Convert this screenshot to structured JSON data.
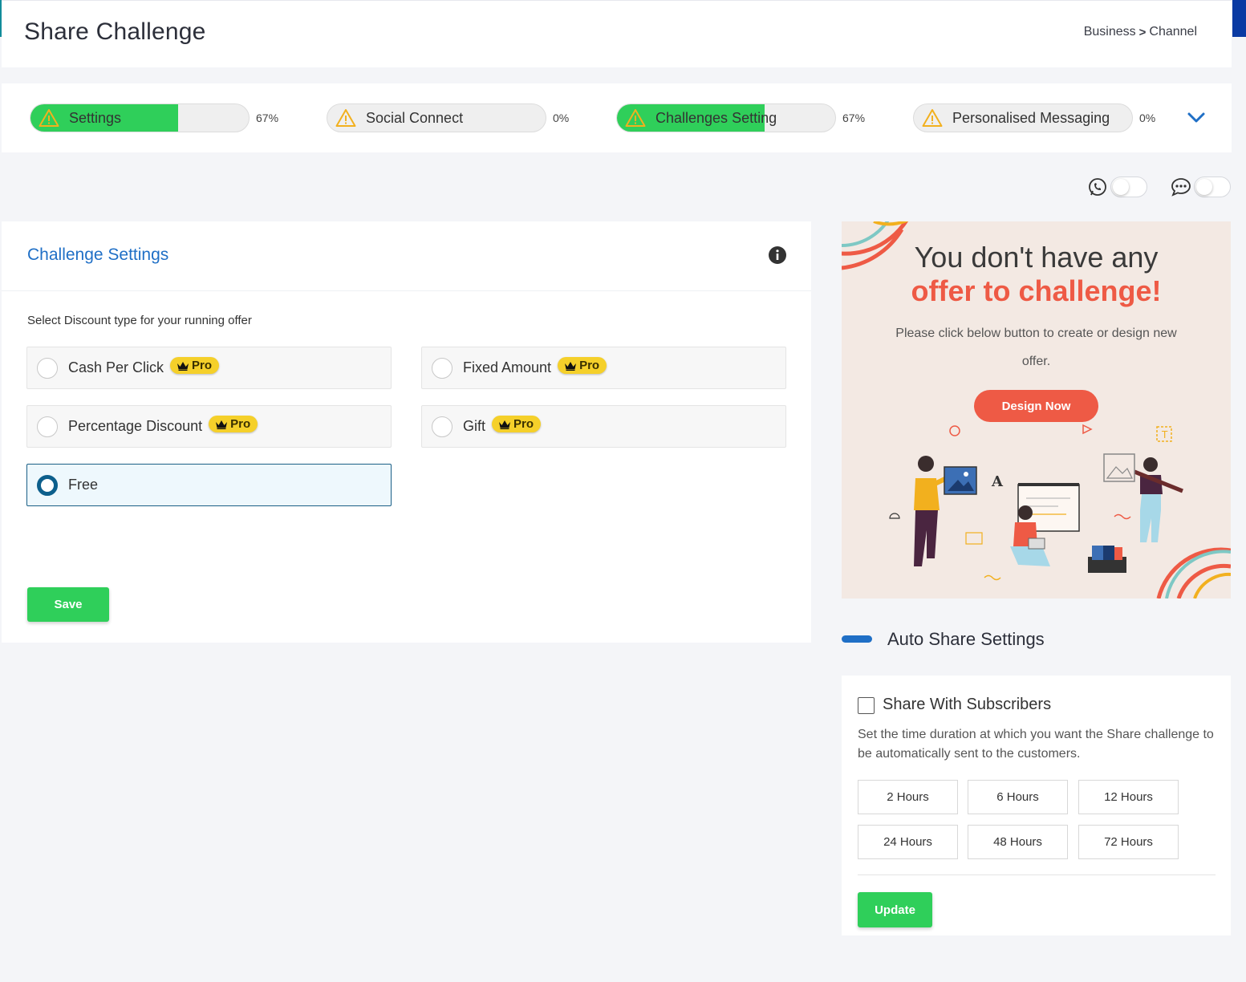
{
  "header": {
    "title": "Share Challenge",
    "breadcrumb": {
      "item1": "Business",
      "separator": ">",
      "item2": "Channel"
    }
  },
  "progress_steps": [
    {
      "label": "Settings",
      "percent_label": "67%",
      "fill": 0.67,
      "icon": "warning-icon"
    },
    {
      "label": "Social Connect",
      "percent_label": "0%",
      "fill": 0,
      "icon": "warning-icon"
    },
    {
      "label": "Challenges Setting",
      "percent_label": "67%",
      "fill": 0.67,
      "icon": "warning-icon"
    },
    {
      "label": "Personalised Messaging",
      "percent_label": "0%",
      "fill": 0,
      "icon": "warning-icon"
    }
  ],
  "toggles": [
    {
      "icon": "whatsapp-icon",
      "on": false
    },
    {
      "icon": "chat-bubble-icon",
      "on": false
    }
  ],
  "challenge_settings": {
    "title": "Challenge Settings",
    "subtitle": "Select Discount type for your running offer",
    "options": [
      {
        "label": "Cash Per Click",
        "pro": true,
        "pro_label": "Pro",
        "selected": false
      },
      {
        "label": "Fixed Amount",
        "pro": true,
        "pro_label": "Pro",
        "selected": false
      },
      {
        "label": "Percentage Discount",
        "pro": true,
        "pro_label": "Pro",
        "selected": false
      },
      {
        "label": "Gift",
        "pro": true,
        "pro_label": "Pro",
        "selected": false
      },
      {
        "label": "Free",
        "pro": false,
        "selected": true
      }
    ],
    "save_label": "Save"
  },
  "promo": {
    "line1": "You don't have any",
    "line2": "offer to challenge!",
    "description": "Please click below button to create or design new offer.",
    "button_label": "Design Now"
  },
  "auto_share": {
    "title": "Auto Share Settings",
    "checkbox_label": "Share With Subscribers",
    "checked": false,
    "description": "Set the time duration at which you want the Share challenge to be automatically sent to the customers.",
    "hours": [
      "2 Hours",
      "6 Hours",
      "12 Hours",
      "24 Hours",
      "48 Hours",
      "72 Hours"
    ],
    "update_label": "Update"
  },
  "colors": {
    "accent_green": "#2fcf5a",
    "link_blue": "#1f6fc6",
    "promo_red": "#ee5a45",
    "pro_yellow": "#f5d02a",
    "selected_border": "#1a5f86"
  }
}
